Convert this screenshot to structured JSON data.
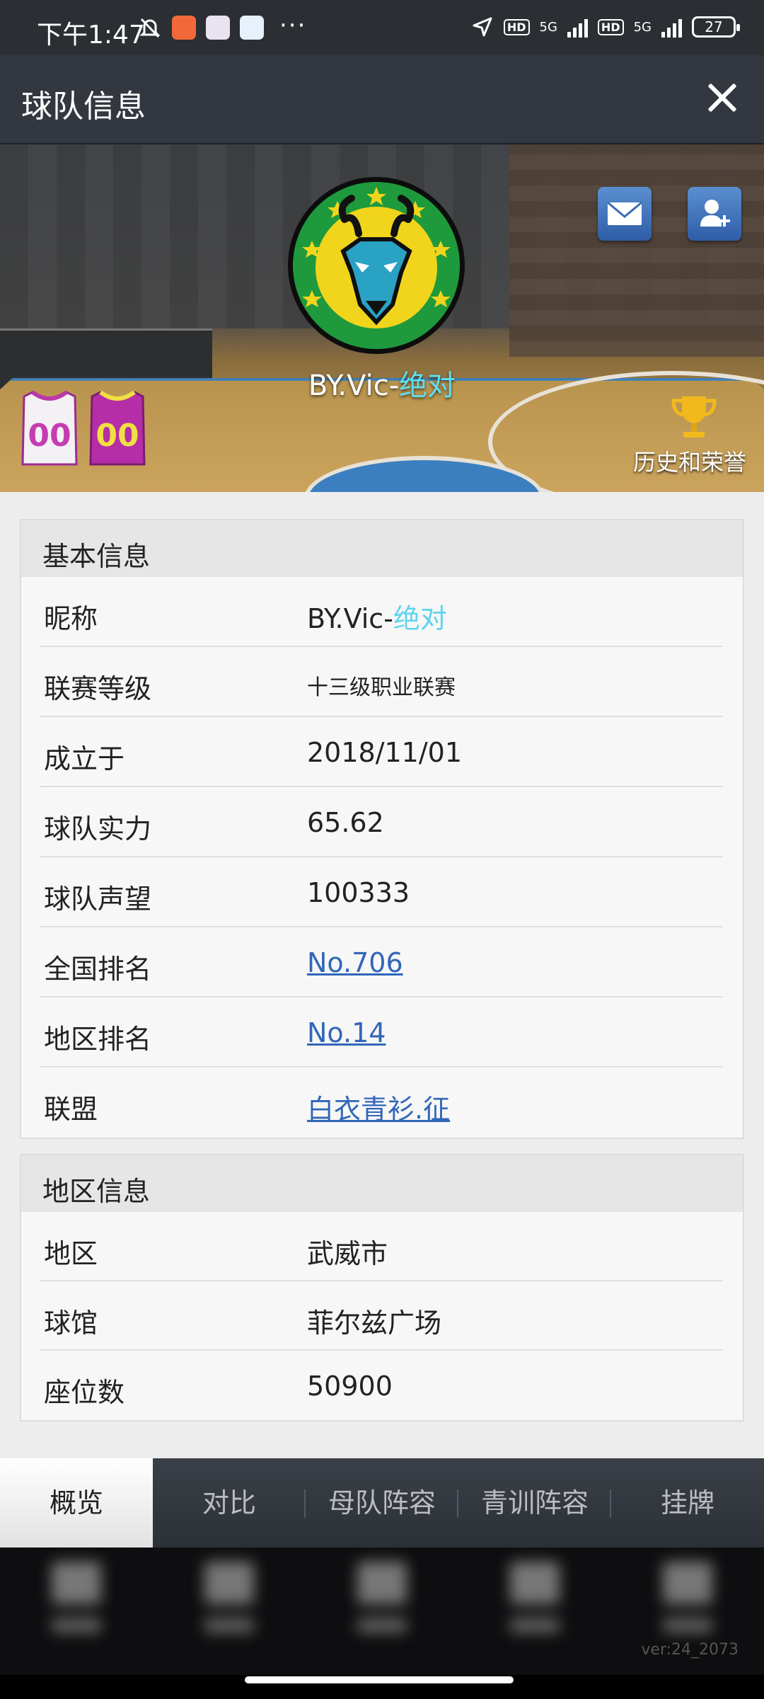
{
  "status_bar": {
    "time": "下午1:47",
    "network_label_1": "5G",
    "network_label_2": "5G",
    "hd_label_1": "HD",
    "hd_label_2": "HD",
    "battery": "27",
    "more": "···"
  },
  "header": {
    "title": "球队信息"
  },
  "banner": {
    "team_name_prefix": "BY.Vic-",
    "team_name_accent": "绝对",
    "jersey_number": "00",
    "honor_label": "历史和荣誉"
  },
  "basic_info": {
    "title": "基本信息",
    "rows": [
      {
        "label": "昵称",
        "value_prefix": "BY.Vic-",
        "value_accent": "绝对"
      },
      {
        "label": "联赛等级",
        "value": "十三级职业联赛"
      },
      {
        "label": "成立于",
        "value": "2018/11/01"
      },
      {
        "label": "球队实力",
        "value": "65.62"
      },
      {
        "label": "球队声望",
        "value": "100333"
      },
      {
        "label": "全国排名",
        "value": "No.706"
      },
      {
        "label": "地区排名",
        "value": "No.14"
      },
      {
        "label": "联盟",
        "value": "白衣青衫.征"
      }
    ]
  },
  "region_info": {
    "title": "地区信息",
    "rows": [
      {
        "label": "地区",
        "value": "武威市"
      },
      {
        "label": "球馆",
        "value": "菲尔兹广场"
      },
      {
        "label": "座位数",
        "value": "50900"
      }
    ]
  },
  "tabs": [
    {
      "label": "概览",
      "active": true
    },
    {
      "label": "对比"
    },
    {
      "label": "母队阵容"
    },
    {
      "label": "青训阵容"
    },
    {
      "label": "挂牌"
    }
  ],
  "version": "ver:24_2073",
  "colors": {
    "accent_cyan": "#5fd3ee",
    "link_blue": "#3166b8",
    "header_bg": "#323740"
  }
}
